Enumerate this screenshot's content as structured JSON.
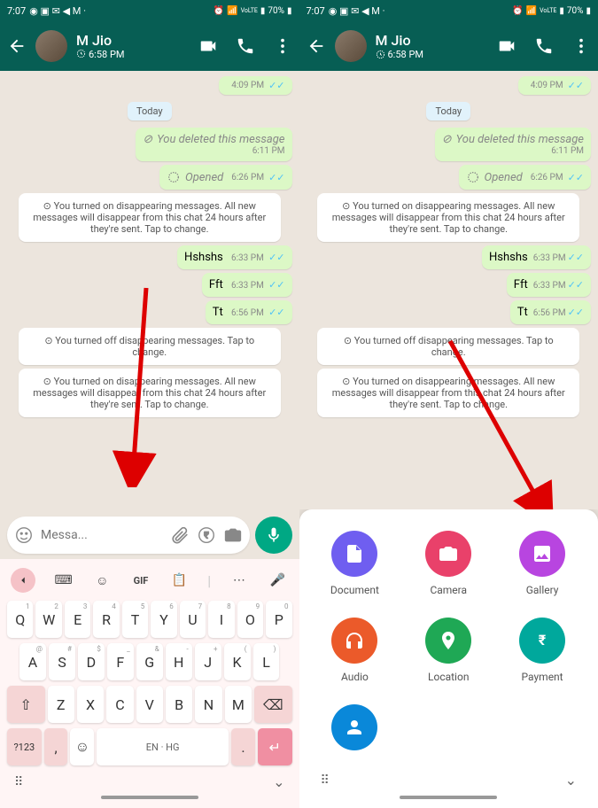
{
  "status": {
    "time": "7:07",
    "battery_text": "70%",
    "network": "LTE1",
    "volte": "VoLTE"
  },
  "header": {
    "contact_name": "M Jio",
    "subtitle_time": "6:58 PM"
  },
  "chat": {
    "top_time": "4:09 PM",
    "divider": "Today",
    "deleted_text": "You deleted this message",
    "deleted_time": "6:11 PM",
    "opened_label": "Opened",
    "opened_time": "6:26 PM",
    "sys_on": "You turned on disappearing messages. All new messages will disappear from this chat 24 hours after they're sent. Tap to change.",
    "sys_off": "You turned off disappearing messages. Tap to change.",
    "sys_on2": "You turned on disappearing messages. All new messages will disappear from this chat 24 hours after they're sent. Tap to change.",
    "msgs": [
      {
        "text": "Hshshs",
        "time": "6:33 PM"
      },
      {
        "text": "Fft",
        "time": "6:33 PM"
      },
      {
        "text": "Tt",
        "time": "6:56 PM"
      }
    ]
  },
  "input": {
    "placeholder": "Messa..."
  },
  "keyboard": {
    "row1": [
      "Q",
      "W",
      "E",
      "R",
      "T",
      "Y",
      "U",
      "I",
      "O",
      "P"
    ],
    "sup1": [
      "1",
      "2",
      "3",
      "4",
      "5",
      "6",
      "7",
      "8",
      "9",
      "0"
    ],
    "row2": [
      "A",
      "S",
      "D",
      "F",
      "G",
      "H",
      "J",
      "K",
      "L"
    ],
    "sup2": [
      "@",
      "#",
      "$",
      "_",
      "&",
      "-",
      "+",
      "(",
      ")"
    ],
    "row3": [
      "Z",
      "X",
      "C",
      "V",
      "B",
      "N",
      "M"
    ],
    "sym_label": "?123",
    "space_label": "EN · HG",
    "gif_label": "GIF"
  },
  "attach": {
    "items": [
      {
        "label": "Document",
        "color": "#6f5ef0",
        "icon": "doc"
      },
      {
        "label": "Camera",
        "color": "#e9416a",
        "icon": "cam"
      },
      {
        "label": "Gallery",
        "color": "#b845e0",
        "icon": "gal"
      },
      {
        "label": "Audio",
        "color": "#eb5a2a",
        "icon": "aud"
      },
      {
        "label": "Location",
        "color": "#1fa855",
        "icon": "loc"
      },
      {
        "label": "Payment",
        "color": "#00a89c",
        "icon": "pay"
      },
      {
        "label": "",
        "color": "#0a88d9",
        "icon": "con"
      }
    ]
  }
}
